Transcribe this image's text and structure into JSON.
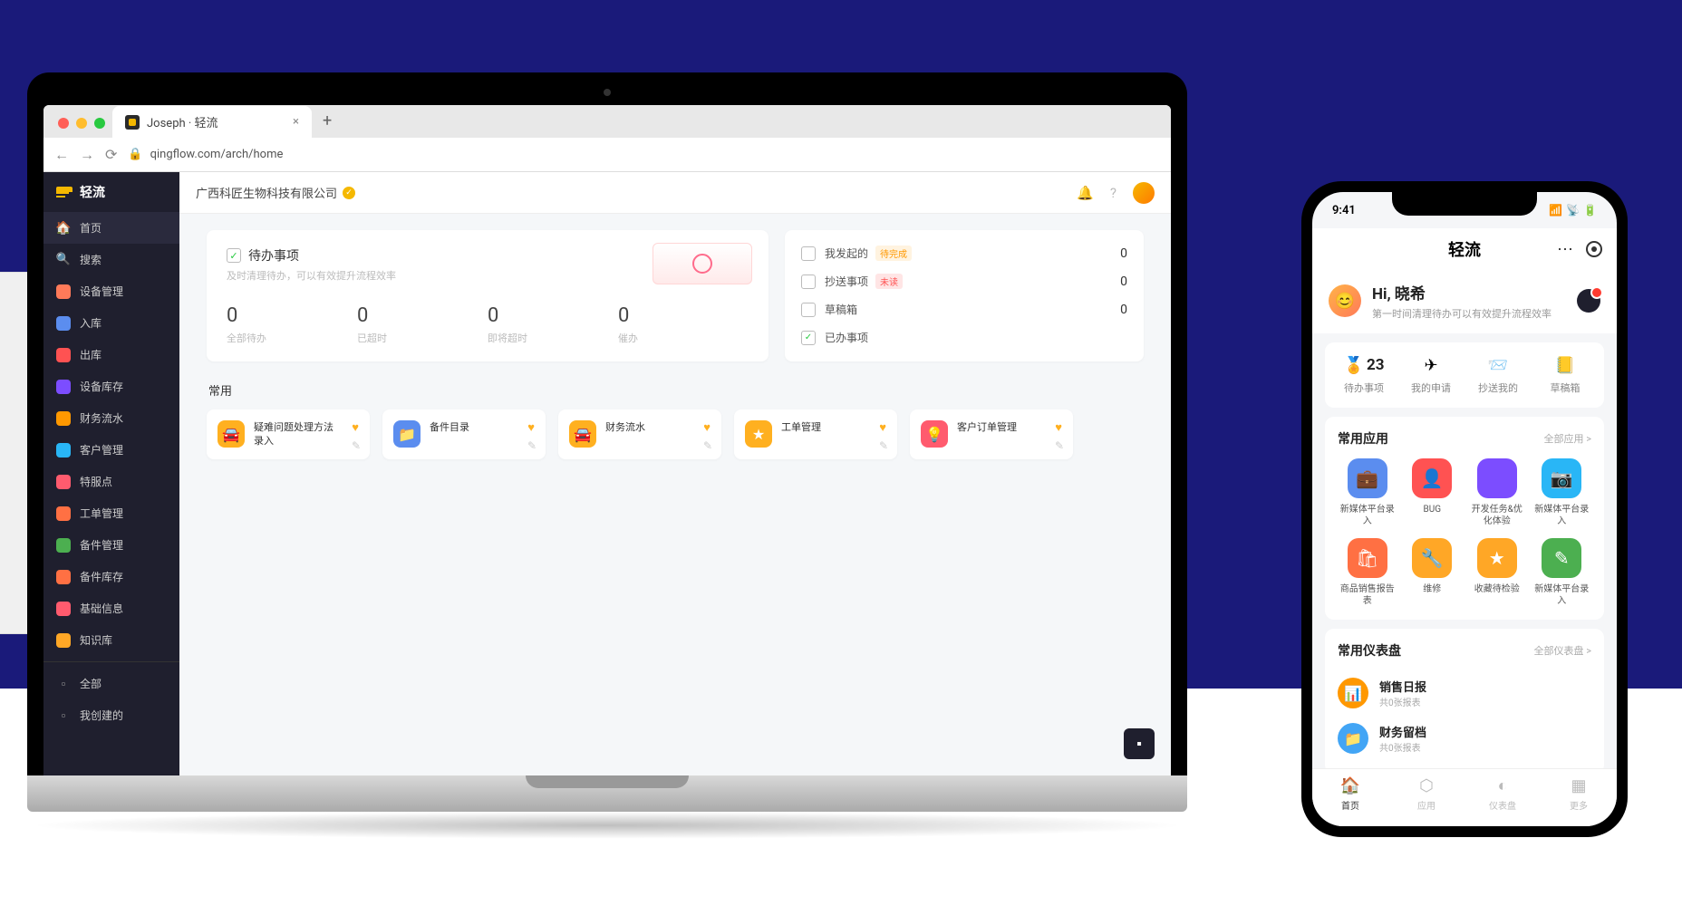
{
  "browser": {
    "tab_title": "Joseph · 轻流",
    "url": "qingflow.com/arch/home"
  },
  "sidebar": {
    "logo": "轻流",
    "items": [
      {
        "icon": "home",
        "label": "首页",
        "color": ""
      },
      {
        "icon": "search",
        "label": "搜索",
        "color": ""
      },
      {
        "icon": "box",
        "label": "设备管理",
        "color": "#ff7a59"
      },
      {
        "icon": "in",
        "label": "入库",
        "color": "#5b8def"
      },
      {
        "icon": "out",
        "label": "出库",
        "color": "#ff5252"
      },
      {
        "icon": "stock",
        "label": "设备库存",
        "color": "#7c4dff"
      },
      {
        "icon": "money",
        "label": "财务流水",
        "color": "#ff9800"
      },
      {
        "icon": "cust",
        "label": "客户管理",
        "color": "#29b6f6"
      },
      {
        "icon": "loc",
        "label": "特服点",
        "color": "#ff5b6e"
      },
      {
        "icon": "ticket",
        "label": "工单管理",
        "color": "#ff7043"
      },
      {
        "icon": "parts",
        "label": "备件管理",
        "color": "#4caf50"
      },
      {
        "icon": "pstock",
        "label": "备件库存",
        "color": "#ff7043"
      },
      {
        "icon": "base",
        "label": "基础信息",
        "color": "#ff5b6e"
      },
      {
        "icon": "kb",
        "label": "知识库",
        "color": "#ffa726"
      }
    ],
    "footer": [
      {
        "label": "全部"
      },
      {
        "label": "我创建的"
      }
    ]
  },
  "appbar": {
    "company": "广西科匠生物科技有限公司"
  },
  "todo": {
    "title": "待办事项",
    "subtitle": "及时清理待办，可以有效提升流程效率",
    "stats": [
      {
        "num": "0",
        "label": "全部待办"
      },
      {
        "num": "0",
        "label": "已超时"
      },
      {
        "num": "0",
        "label": "即将超时"
      },
      {
        "num": "0",
        "label": "催办"
      }
    ]
  },
  "status": {
    "rows": [
      {
        "label": "我发起的",
        "tag": "待完成",
        "tagClass": "tag-orange",
        "count": "0"
      },
      {
        "label": "抄送事项",
        "tag": "未读",
        "tagClass": "tag-red",
        "count": "0"
      },
      {
        "label": "草稿箱",
        "tag": "",
        "tagClass": "",
        "count": "0"
      },
      {
        "label": "已办事项",
        "tag": "",
        "tagClass": "",
        "count": ""
      }
    ]
  },
  "common": {
    "title": "常用",
    "cards": [
      {
        "name": "疑难问题处理方法录入",
        "iconClass": "ai-orange",
        "glyph": "🚘"
      },
      {
        "name": "备件目录",
        "iconClass": "ai-blue",
        "glyph": "📁"
      },
      {
        "name": "财务流水",
        "iconClass": "ai-orange",
        "glyph": "🚘"
      },
      {
        "name": "工单管理",
        "iconClass": "ai-orange",
        "glyph": "★"
      },
      {
        "name": "客户订单管理",
        "iconClass": "ai-red",
        "glyph": "💡"
      }
    ]
  },
  "phone": {
    "time": "9:41",
    "app_title": "轻流",
    "greeting": "Hi, 晓希",
    "greeting_sub": "第一时间清理待办可以有效提升流程效率",
    "quick": [
      {
        "glyph": "🏅",
        "num": "23",
        "label": "待办事项"
      },
      {
        "glyph": "✈",
        "num": "",
        "label": "我的申请"
      },
      {
        "glyph": "📨",
        "num": "",
        "label": "抄送我的"
      },
      {
        "glyph": "📒",
        "num": "",
        "label": "草稿箱"
      }
    ],
    "apps_section": {
      "title": "常用应用",
      "link": "全部应用 >"
    },
    "apps": [
      {
        "iconClass": "mi-blue",
        "glyph": "💼",
        "label": "新媒体平台录入"
      },
      {
        "iconClass": "mi-red",
        "glyph": "👤",
        "label": "BUG"
      },
      {
        "iconClass": "mi-purple",
        "glyph": "</>",
        "label": "开发任务&优化体验"
      },
      {
        "iconClass": "mi-cyan",
        "glyph": "📷",
        "label": "新媒体平台录入"
      },
      {
        "iconClass": "mi-orange",
        "glyph": "🛍",
        "label": "商品销售报告表"
      },
      {
        "iconClass": "mi-amber",
        "glyph": "🔧",
        "label": "维修"
      },
      {
        "iconClass": "mi-amber",
        "glyph": "★",
        "label": "收藏待检验"
      },
      {
        "iconClass": "mi-green",
        "glyph": "✎",
        "label": "新媒体平台录入"
      }
    ],
    "dash_section": {
      "title": "常用仪表盘",
      "link": "全部仪表盘 >"
    },
    "dash": [
      {
        "iconClass": "di-orange",
        "glyph": "📊",
        "title": "销售日报",
        "sub": "共0张报表"
      },
      {
        "iconClass": "di-blue",
        "glyph": "📁",
        "title": "财务留档",
        "sub": "共0张报表"
      }
    ],
    "tabs": [
      {
        "glyph": "🏠",
        "label": "首页"
      },
      {
        "glyph": "⬡",
        "label": "应用"
      },
      {
        "glyph": "◐",
        "label": "仪表盘"
      },
      {
        "glyph": "▦",
        "label": "更多"
      }
    ]
  }
}
